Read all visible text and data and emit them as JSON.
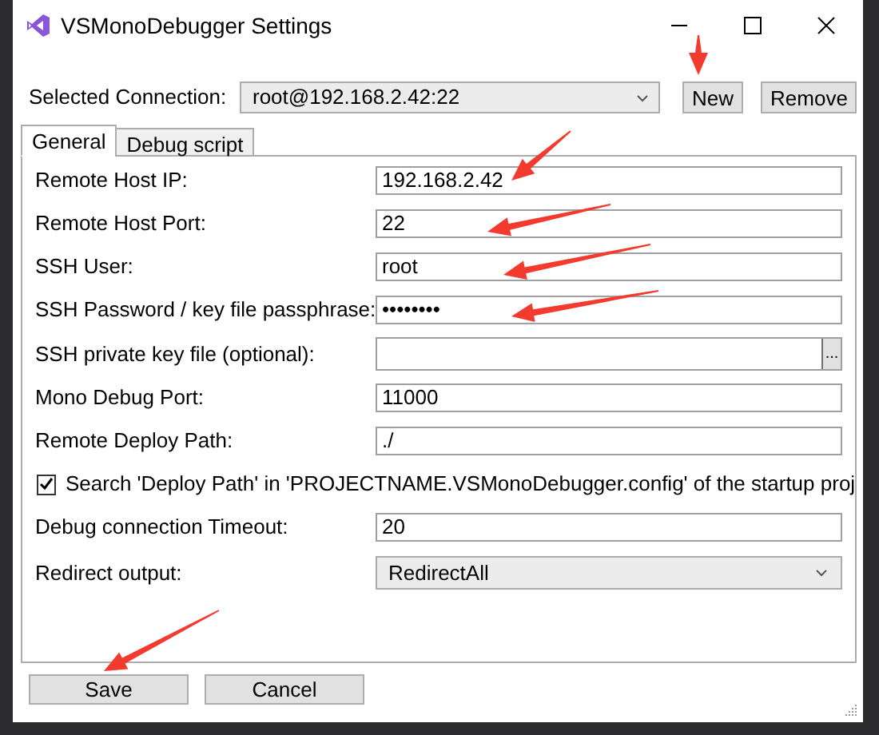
{
  "window": {
    "title": "VSMonoDebugger Settings"
  },
  "connection": {
    "label": "Selected Connection:",
    "value": "root@192.168.2.42:22",
    "buttons": [
      "New",
      "Remove"
    ]
  },
  "tabs": [
    {
      "label": "General",
      "selected": true
    },
    {
      "label": "Debug script",
      "selected": false
    }
  ],
  "fields": [
    {
      "kind": "text",
      "label": "Remote Host IP:",
      "value": "192.168.2.42"
    },
    {
      "kind": "text",
      "label": "Remote Host Port:",
      "value": "22"
    },
    {
      "kind": "text",
      "label": "SSH User:",
      "value": "root"
    },
    {
      "kind": "text",
      "label": "SSH Password / key file passphrase:",
      "value": "••••••••"
    },
    {
      "kind": "file",
      "label": "SSH private key file (optional):",
      "button": "..."
    },
    {
      "kind": "text",
      "label": "Mono Debug Port:",
      "value": "11000"
    },
    {
      "kind": "text",
      "label": "Remote Deploy Path:",
      "value": "./"
    },
    {
      "kind": "checkbox",
      "label": "Search 'Deploy Path' in 'PROJECTNAME.VSMonoDebugger.config' of the startup proj",
      "checked": true
    },
    {
      "kind": "text",
      "label": "Debug connection Timeout:",
      "value": "20"
    },
    {
      "kind": "dropdown",
      "label": "Redirect output:",
      "value": "RedirectAll"
    }
  ],
  "buttons": [
    "Save",
    "Cancel"
  ]
}
